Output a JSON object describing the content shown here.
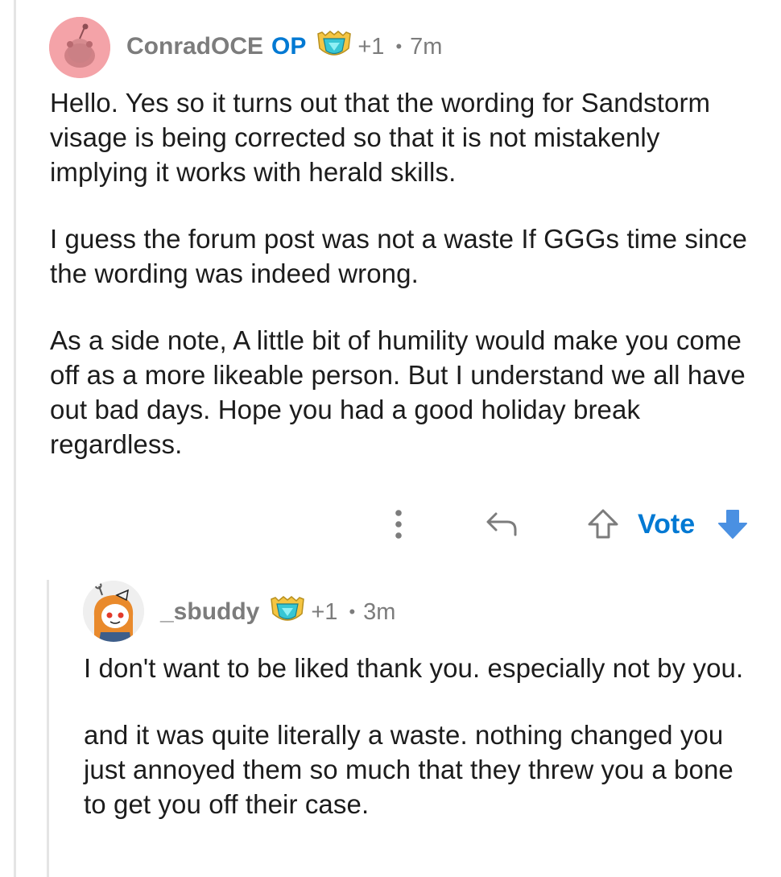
{
  "comments": [
    {
      "username": "ConradOCE",
      "op_tag": "OP",
      "award_count": "+1",
      "age": "7m",
      "avatar_icon": "snoo-avatar-pink",
      "award_icon": "helpful-award-icon",
      "paragraphs": [
        "Hello. Yes so it turns out that the wording for Sandstorm visage is being corrected so that it is not mistakenly implying it works with herald skills.",
        "I guess the forum post was not a waste If GGGs time since the wording was indeed wrong.",
        "As a side note, A little bit of humility would make you come off as a more likeable person. But I understand we all have out bad days. Hope you had a good holiday break regardless."
      ],
      "actions": {
        "more_icon": "vertical-ellipsis-icon",
        "reply_icon": "reply-arrow-icon",
        "upvote_icon": "upvote-arrow-icon",
        "vote_label": "Vote",
        "downvote_icon": "downvote-arrow-icon"
      }
    },
    {
      "username": "_sbuddy",
      "award_count": "+1",
      "age": "3m",
      "avatar_icon": "snoo-avatar-orange-hair",
      "award_icon": "helpful-award-icon",
      "paragraphs": [
        "I don't want to be liked thank you. especially not by you.",
        "and it was quite literally a waste. nothing changed you just annoyed them so much that they threw you a bone to get you off their case."
      ]
    }
  ],
  "colors": {
    "accent_blue": "#0079d3",
    "meta_gray": "#7c7c7c",
    "thread_line": "#e4e4e4",
    "avatar_pink": "#f4a3a8",
    "downvote_blue": "#4a90e2"
  }
}
